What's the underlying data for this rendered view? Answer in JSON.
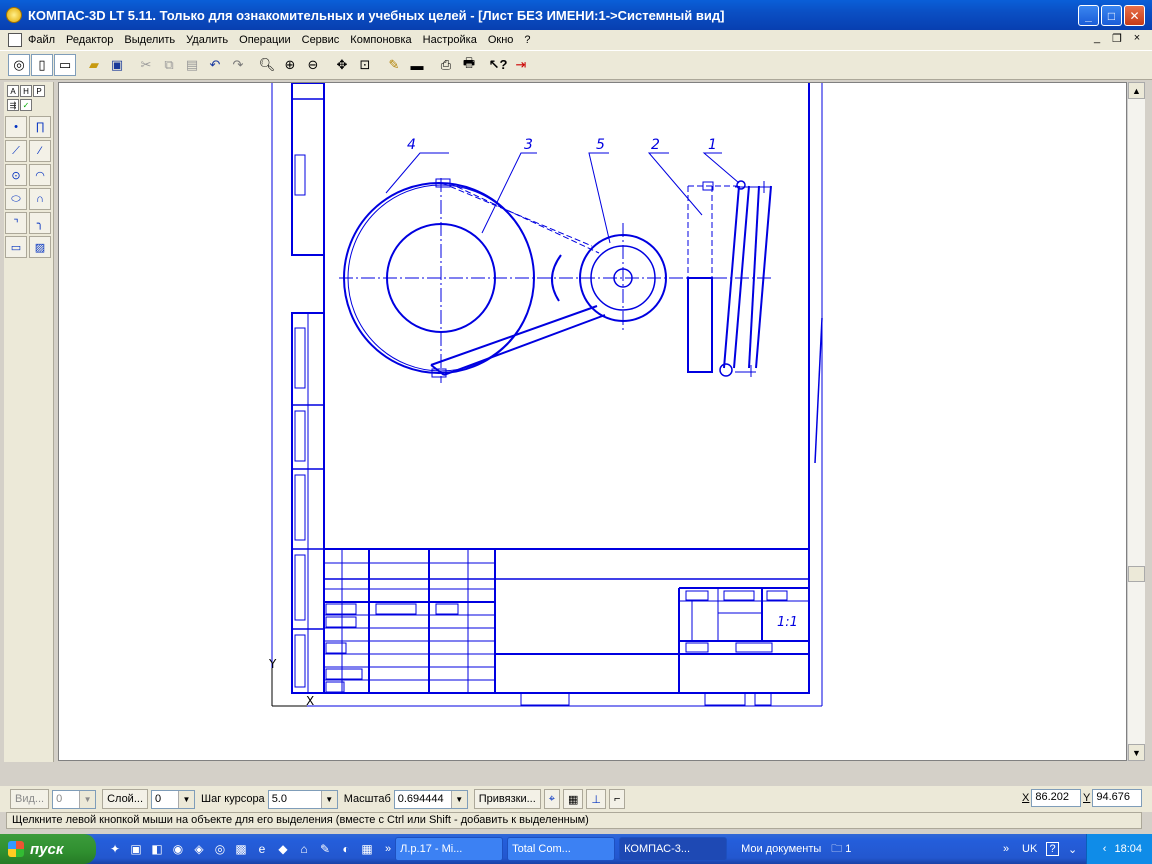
{
  "window": {
    "title": "КОМПАС-3D LT 5.11. Только для ознакомительных и учебных целей - [Лист БЕЗ ИМЕНИ:1->Системный вид]"
  },
  "menu": [
    "Файл",
    "Редактор",
    "Выделить",
    "Удалить",
    "Операции",
    "Сервис",
    "Компоновка",
    "Настройка",
    "Окно",
    "?"
  ],
  "mdi_controls": [
    "_",
    "❐",
    "×"
  ],
  "toolbar_icons": [
    "new-3d-icon",
    "new-sheet-icon",
    "new-document-icon",
    "open-icon",
    "save-icon",
    "cut-icon",
    "copy-icon",
    "paste-icon",
    "undo-icon",
    "redo-icon",
    "zoom-icon",
    "zoom-in-icon",
    "zoom-out-icon",
    "pan-icon",
    "zoom-fit-icon",
    "edit-icon",
    "regenerate-icon",
    "preview-icon",
    "print-icon",
    "help-icon",
    "exit-icon"
  ],
  "palette": {
    "tabs": [
      "А",
      "Н",
      "Р"
    ],
    "tools": [
      "point-icon",
      "aux-line-icon",
      "segment-icon",
      "parallel-segment-icon",
      "circle-icon",
      "arc-icon",
      "ellipse-icon",
      "bezier-icon",
      "chamfer-icon",
      "fillet-icon",
      "rectangle-icon",
      "hatch-icon"
    ]
  },
  "drawing": {
    "leader_labels": [
      "4",
      "3",
      "5",
      "2",
      "1"
    ],
    "sheet_number": "1:1",
    "axis_x": "X",
    "axis_y": "Y"
  },
  "propbar": {
    "view_btn": "Вид...",
    "view_value": "0",
    "layer_btn": "Слой...",
    "layer_value": "0",
    "step_label": "Шаг курсора",
    "step_value": "5.0",
    "scale_label": "Масштаб",
    "scale_value": "0.694444",
    "snaps_btn": "Привязки...",
    "x_label": "X",
    "x_value": "86.202",
    "y_label": "Y",
    "y_value": "94.676"
  },
  "hint": "Щелкните левой кнопкой мыши на объекте для его выделения (вместе с Ctrl или Shift - добавить к выделенным)",
  "taskbar": {
    "start": "пуск",
    "tasks": [
      "Л.р.17 - Mi...",
      "Total Com...",
      "КОМПАС-3..."
    ],
    "docs_label": "Мои документы",
    "folder_label": "1",
    "lang": "UK",
    "time": "18:04"
  },
  "colors": {
    "drawing": "#0000e0",
    "titlebar": "#0a4fc4"
  }
}
